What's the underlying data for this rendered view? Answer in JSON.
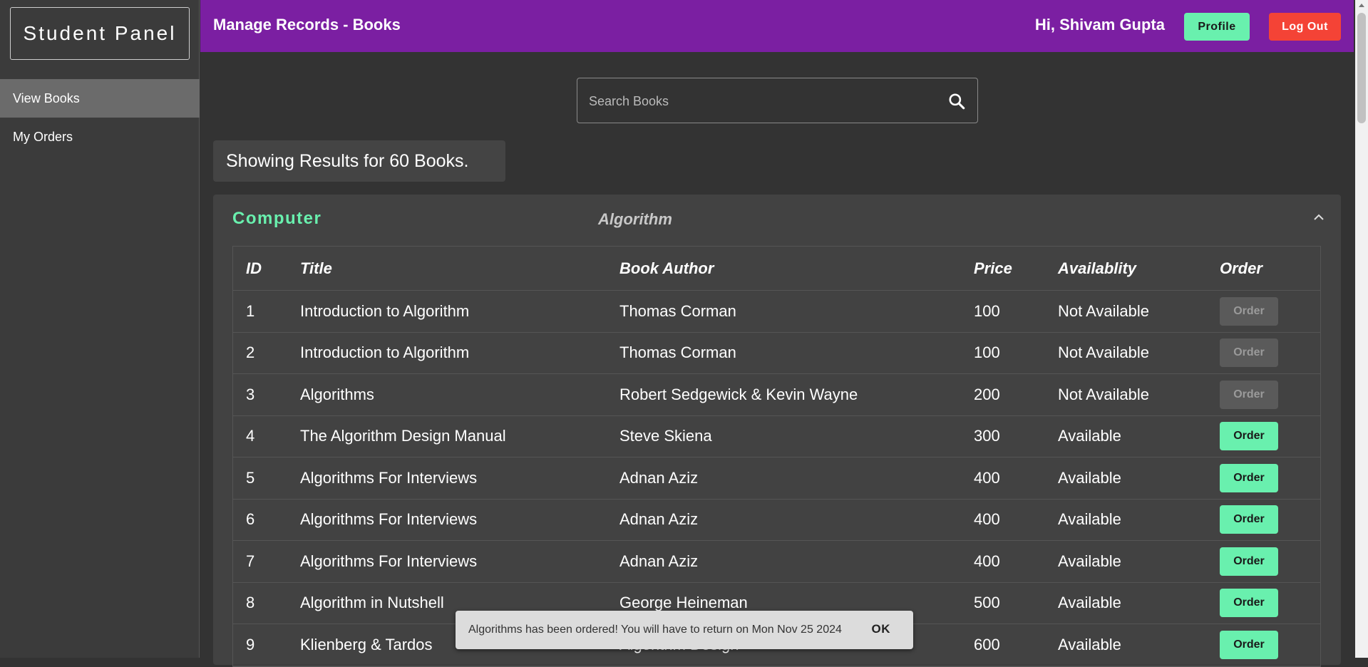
{
  "sidebar": {
    "brand": "Student Panel",
    "items": [
      {
        "label": "View Books",
        "active": true
      },
      {
        "label": "My Orders",
        "active": false
      }
    ]
  },
  "header": {
    "title": "Manage Records - Books",
    "greeting": "Hi, Shivam Gupta",
    "profile_label": "Profile",
    "logout_label": "Log Out",
    "accent_color": "#7b1fa2"
  },
  "search": {
    "placeholder": "Search Books",
    "value": "",
    "icon": "search-icon"
  },
  "results_text": "Showing Results for 60 Books.",
  "section": {
    "category": "Computer",
    "subcategory": "Algorithm",
    "collapse_icon": "chevron-up-icon"
  },
  "table": {
    "headers": [
      "ID",
      "Title",
      "Book Author",
      "Price",
      "Availablity",
      "Order"
    ],
    "order_label": "Order",
    "rows": [
      {
        "id": "1",
        "title": "Introduction to Algorithm",
        "author": "Thomas Corman",
        "price": "100",
        "availability": "Not Available",
        "orderable": false
      },
      {
        "id": "2",
        "title": "Introduction to Algorithm",
        "author": "Thomas Corman",
        "price": "100",
        "availability": "Not Available",
        "orderable": false
      },
      {
        "id": "3",
        "title": "Algorithms",
        "author": "Robert Sedgewick & Kevin Wayne",
        "price": "200",
        "availability": "Not Available",
        "orderable": false
      },
      {
        "id": "4",
        "title": "The Algorithm Design Manual",
        "author": "Steve Skiena",
        "price": "300",
        "availability": "Available",
        "orderable": true
      },
      {
        "id": "5",
        "title": "Algorithms For Interviews",
        "author": "Adnan Aziz",
        "price": "400",
        "availability": "Available",
        "orderable": true
      },
      {
        "id": "6",
        "title": "Algorithms For Interviews",
        "author": "Adnan Aziz",
        "price": "400",
        "availability": "Available",
        "orderable": true
      },
      {
        "id": "7",
        "title": "Algorithms For Interviews",
        "author": "Adnan Aziz",
        "price": "400",
        "availability": "Available",
        "orderable": true
      },
      {
        "id": "8",
        "title": "Algorithm in Nutshell",
        "author": "George Heineman",
        "price": "500",
        "availability": "Available",
        "orderable": true
      },
      {
        "id": "9",
        "title": "Klienberg & Tardos",
        "author": "Algorithm Design",
        "price": "600",
        "availability": "Available",
        "orderable": true
      }
    ]
  },
  "snackbar": {
    "message": "Algorithms has been ordered! You will have to return on Mon Nov 25 2024",
    "action_label": "OK"
  },
  "colors": {
    "order_enabled": "#69f0ae",
    "logout": "#f44336",
    "category": "#69f0ae"
  }
}
